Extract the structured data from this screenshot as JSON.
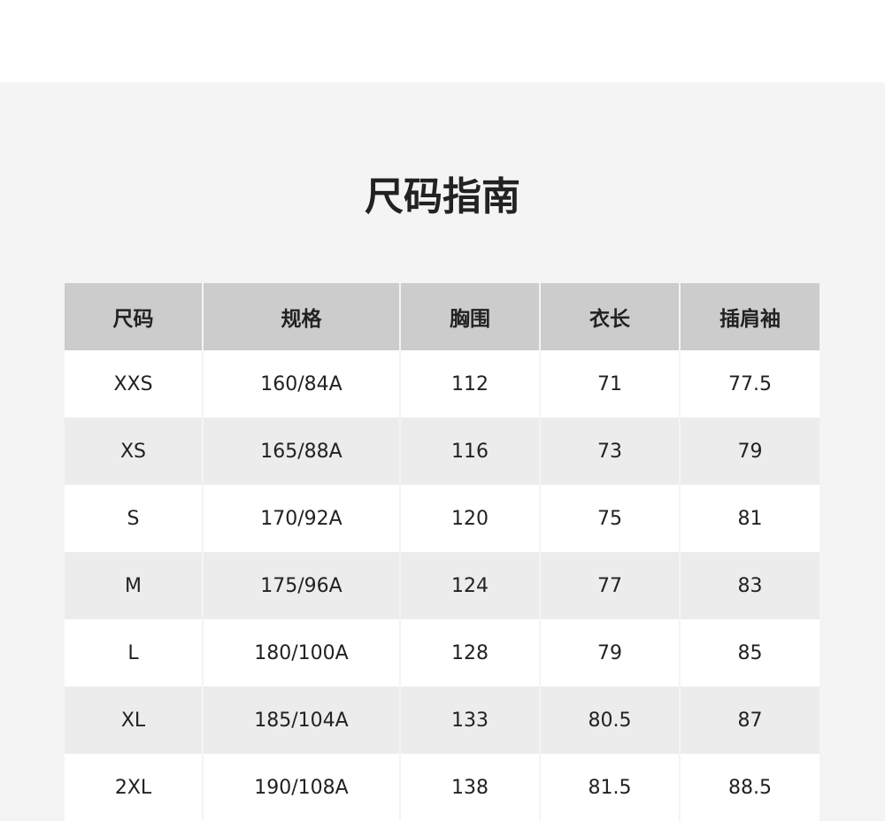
{
  "page": {
    "title": "尺码指南"
  },
  "table": {
    "headers": [
      "尺码",
      "规格",
      "胸围",
      "衣长",
      "插肩袖"
    ],
    "rows": [
      [
        "XXS",
        "160/84A",
        "112",
        "71",
        "77.5"
      ],
      [
        "XS",
        "165/88A",
        "116",
        "73",
        "79"
      ],
      [
        "S",
        "170/92A",
        "120",
        "75",
        "81"
      ],
      [
        "M",
        "175/96A",
        "124",
        "77",
        "83"
      ],
      [
        "L",
        "180/100A",
        "128",
        "79",
        "85"
      ],
      [
        "XL",
        "185/104A",
        "133",
        "80.5",
        "87"
      ],
      [
        "2XL",
        "190/108A",
        "138",
        "81.5",
        "88.5"
      ]
    ]
  },
  "colors": {
    "panel_background": "#f4f4f4",
    "header_background": "#cccccc",
    "row_light": "#ffffff",
    "row_dark": "#ececec",
    "text": "#222222"
  }
}
